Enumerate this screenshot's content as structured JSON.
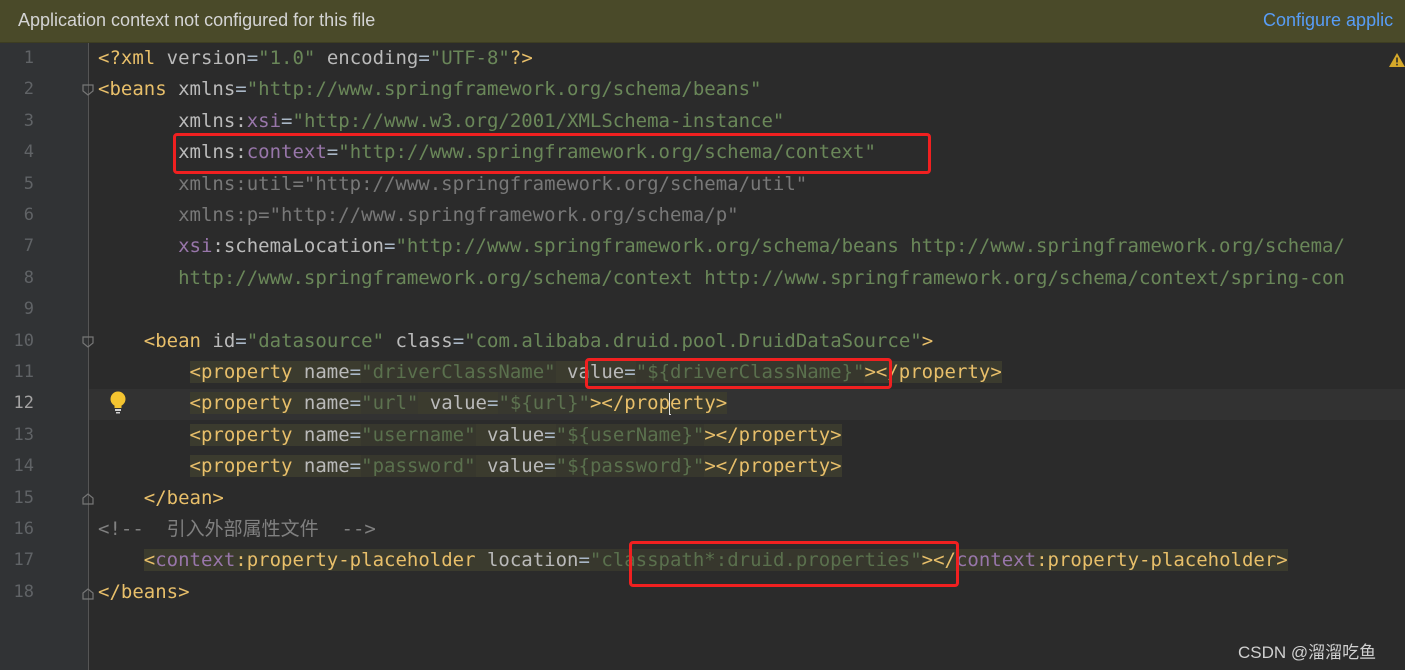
{
  "banner": {
    "message": "Application context not configured for this file",
    "link": "Configure applic"
  },
  "editor": {
    "current_line": 12,
    "lines": [
      {
        "n": "1",
        "parts": [
          [
            "pi",
            "<?xml "
          ],
          [
            "attr",
            "version"
          ],
          [
            "text",
            "="
          ],
          [
            "val",
            "\"1.0\""
          ],
          [
            "text",
            " "
          ],
          [
            "attr",
            "encoding"
          ],
          [
            "text",
            "="
          ],
          [
            "val",
            "\"UTF-8\""
          ],
          [
            "pi",
            "?>"
          ]
        ]
      },
      {
        "n": "2",
        "parts": [
          [
            "tag",
            "<beans "
          ],
          [
            "attr",
            "xmlns"
          ],
          [
            "text",
            "="
          ],
          [
            "val",
            "\"http://www.springframework.org/schema/beans\""
          ]
        ]
      },
      {
        "n": "3",
        "parts": [
          [
            "text",
            "       "
          ],
          [
            "attr",
            "xmlns:"
          ],
          [
            "ns",
            "xsi"
          ],
          [
            "text",
            "="
          ],
          [
            "val",
            "\"http://www.w3.org/2001/XMLSchema-instance\""
          ]
        ]
      },
      {
        "n": "4",
        "parts": [
          [
            "text",
            "       "
          ],
          [
            "attr",
            "xmlns:"
          ],
          [
            "ns",
            "context"
          ],
          [
            "text",
            "="
          ],
          [
            "val",
            "\"http://www.springframework.org/schema/context\""
          ]
        ]
      },
      {
        "n": "5",
        "parts": [
          [
            "text",
            "       "
          ],
          [
            "dim",
            "xmlns:util=\"http://www.springframework.org/schema/util\""
          ]
        ]
      },
      {
        "n": "6",
        "parts": [
          [
            "text",
            "       "
          ],
          [
            "dim",
            "xmlns:p=\"http://www.springframework.org/schema/p\""
          ]
        ]
      },
      {
        "n": "7",
        "parts": [
          [
            "text",
            "       "
          ],
          [
            "ns",
            "xsi"
          ],
          [
            "attr",
            ":schemaLocation"
          ],
          [
            "text",
            "="
          ],
          [
            "val",
            "\"http://www.springframework.org/schema/beans http://www.springframework.org/schema/"
          ]
        ]
      },
      {
        "n": "8",
        "parts": [
          [
            "text",
            "       "
          ],
          [
            "val",
            "http://www.springframework.org/schema/context http://www.springframework.org/schema/context/spring-con"
          ]
        ]
      },
      {
        "n": "9",
        "parts": []
      },
      {
        "n": "10",
        "parts": [
          [
            "text",
            "    "
          ],
          [
            "tag",
            "<bean "
          ],
          [
            "attr",
            "id"
          ],
          [
            "text",
            "="
          ],
          [
            "val",
            "\"datasource\""
          ],
          [
            "text",
            " "
          ],
          [
            "attr",
            "class"
          ],
          [
            "text",
            "="
          ],
          [
            "val",
            "\"com.alibaba.druid.pool.DruidDataSource\""
          ],
          [
            "tag",
            ">"
          ]
        ]
      },
      {
        "n": "11",
        "parts": [
          [
            "text",
            "        "
          ],
          [
            "tag hl",
            "<property"
          ],
          [
            "attr hl",
            " name"
          ],
          [
            "text hl",
            "="
          ],
          [
            "dimval hl",
            "\"driverClassName\""
          ],
          [
            "text hl",
            " "
          ],
          [
            "attr hl",
            "value"
          ],
          [
            "text hl",
            "="
          ],
          [
            "dimval hl",
            "\"${driverClassName}\""
          ],
          [
            "tag hl",
            "></property>"
          ]
        ]
      },
      {
        "n": "12",
        "parts": [
          [
            "text",
            "        "
          ],
          [
            "tag hl",
            "<property"
          ],
          [
            "attr hl",
            " name"
          ],
          [
            "text hl",
            "="
          ],
          [
            "dimval hl",
            "\"url\""
          ],
          [
            "text hl",
            " "
          ],
          [
            "attr hl",
            "value"
          ],
          [
            "text hl",
            "="
          ],
          [
            "dimval hl",
            "\"${url}\""
          ],
          [
            "tag hl",
            "></prop"
          ],
          [
            "caret",
            ""
          ],
          [
            "tag hl",
            "erty>"
          ]
        ]
      },
      {
        "n": "13",
        "parts": [
          [
            "text",
            "        "
          ],
          [
            "tag hl",
            "<property"
          ],
          [
            "attr hl",
            " name"
          ],
          [
            "text hl",
            "="
          ],
          [
            "dimval hl",
            "\"username\""
          ],
          [
            "text hl",
            " "
          ],
          [
            "attr hl",
            "value"
          ],
          [
            "text hl",
            "="
          ],
          [
            "dimval hl",
            "\"${userName}\""
          ],
          [
            "tag hl",
            "></property>"
          ]
        ]
      },
      {
        "n": "14",
        "parts": [
          [
            "text",
            "        "
          ],
          [
            "tag hl",
            "<property"
          ],
          [
            "attr hl",
            " name"
          ],
          [
            "text hl",
            "="
          ],
          [
            "dimval hl",
            "\"password\""
          ],
          [
            "text hl",
            " "
          ],
          [
            "attr hl",
            "value"
          ],
          [
            "text hl",
            "="
          ],
          [
            "dimval hl",
            "\"${password}\""
          ],
          [
            "tag hl",
            "></property>"
          ]
        ]
      },
      {
        "n": "15",
        "parts": [
          [
            "text",
            "    "
          ],
          [
            "tag",
            "</bean>"
          ]
        ]
      },
      {
        "n": "16",
        "parts": [
          [
            "cmt",
            "<!--  引入外部属性文件  -->"
          ]
        ]
      },
      {
        "n": "17",
        "parts": [
          [
            "text",
            "    "
          ],
          [
            "tag hl",
            "<"
          ],
          [
            "ns hl",
            "context"
          ],
          [
            "tag hl",
            ":property-placeholder"
          ],
          [
            "attr hl",
            " location"
          ],
          [
            "text hl",
            "="
          ],
          [
            "dimval hl",
            "\"classpath*:druid.properties\""
          ],
          [
            "tag hl",
            "></"
          ],
          [
            "ns hl",
            "context"
          ],
          [
            "tag hl",
            ":property-placeholder>"
          ]
        ]
      },
      {
        "n": "18",
        "parts": [
          [
            "tag",
            "</beans>"
          ]
        ]
      }
    ]
  },
  "icons": {
    "warning": "warning-triangle-icon",
    "bulb": "lightbulb-icon",
    "fold": "fold-marker-icon"
  },
  "watermark": "CSDN @溜溜吃鱼"
}
